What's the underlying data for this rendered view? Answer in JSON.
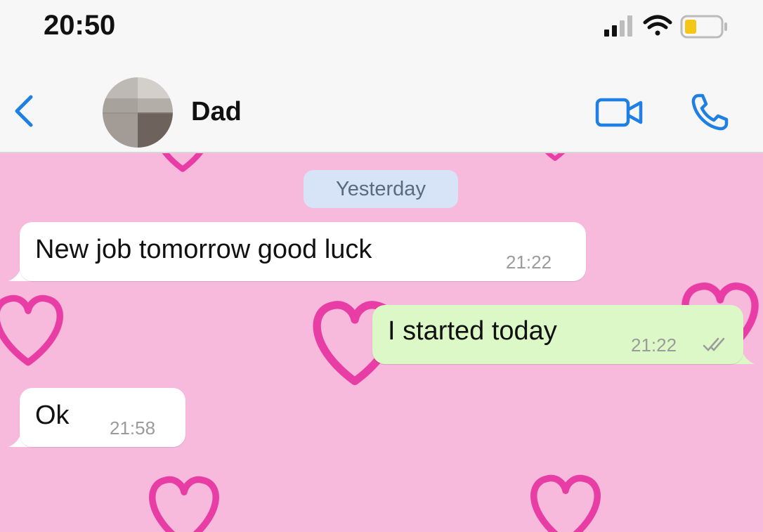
{
  "status_bar": {
    "time": "20:50",
    "icons": [
      "signal-icon",
      "wifi-icon",
      "battery-icon"
    ],
    "battery_color": "#f5c518"
  },
  "header": {
    "back_icon": "chevron-left-icon",
    "contact_name": "Dad",
    "video_icon": "video-camera-icon",
    "call_icon": "phone-icon",
    "accent_color": "#1f7fe3"
  },
  "chat": {
    "background_color": "#f7b9dc",
    "pattern_color": "#e6279a",
    "date_separator": "Yesterday",
    "messages": [
      {
        "direction": "incoming",
        "text": "New job tomorrow good luck",
        "time": "21:22"
      },
      {
        "direction": "outgoing",
        "text": "I started today",
        "time": "21:22",
        "status_icon": "double-check-icon"
      },
      {
        "direction": "incoming",
        "text": "Ok",
        "time": "21:58"
      }
    ]
  }
}
